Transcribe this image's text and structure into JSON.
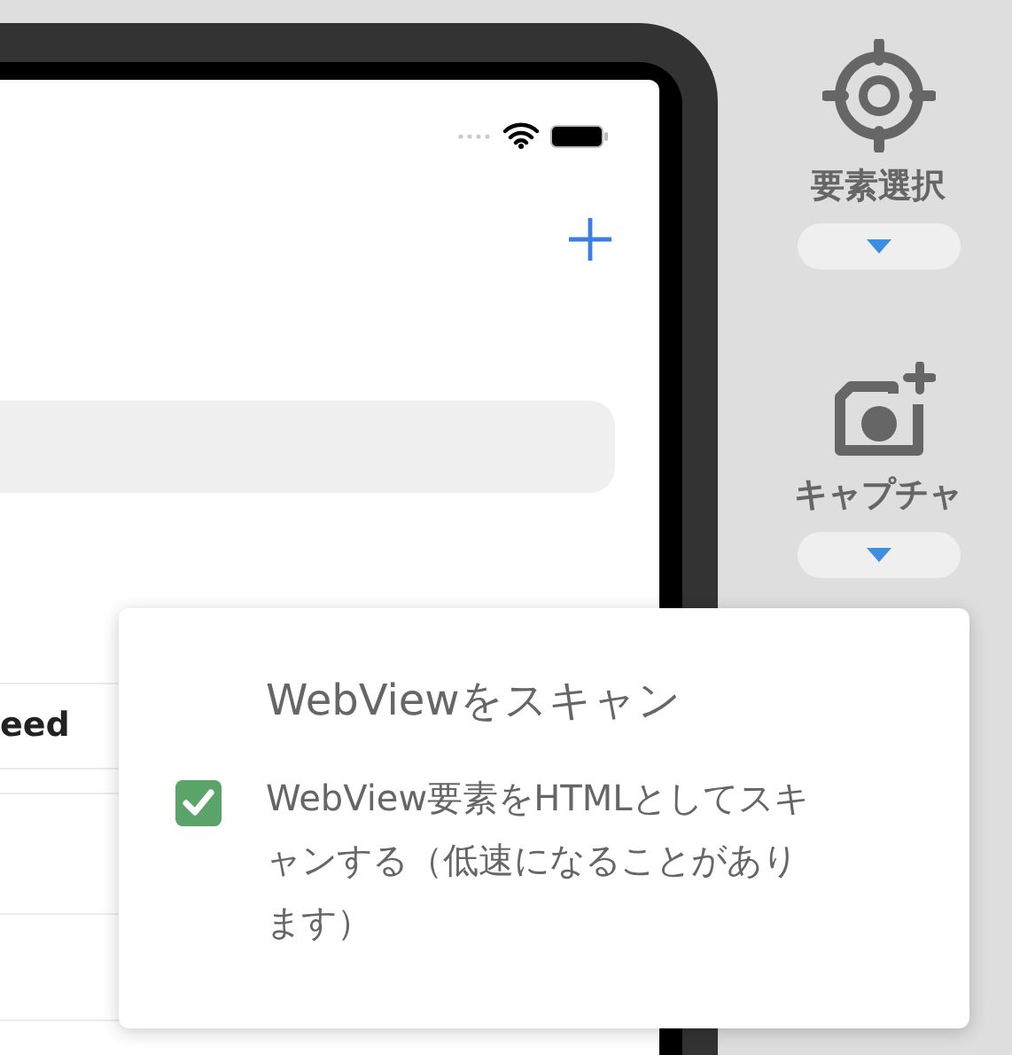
{
  "table": {
    "columns": [
      "eed"
    ]
  },
  "toolbar": {
    "tools": [
      {
        "kind": "target",
        "label": "要素選択"
      },
      {
        "kind": "camera",
        "label": "キャプチャ"
      }
    ]
  },
  "popup": {
    "title": "WebViewをスキャン",
    "option": {
      "label": "WebView要素をHTMLとしてスキャンする（低速になることがあります）",
      "checked": true
    }
  }
}
